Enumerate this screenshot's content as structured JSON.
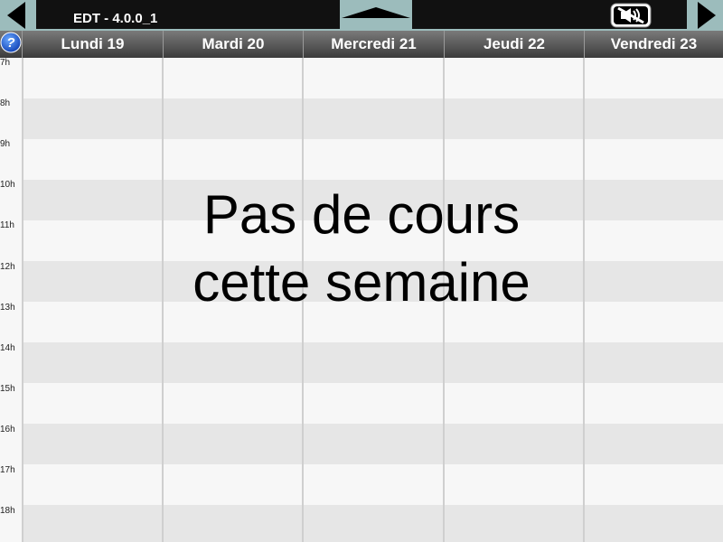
{
  "topbar": {
    "title": "EDT - 4.0.0_1",
    "prev_icon": "triangle-left-icon",
    "next_icon": "triangle-right-icon",
    "collapse_icon": "triangle-up-icon",
    "mute_icon": "mute-icon"
  },
  "help_icon": "help-icon",
  "days": [
    "Lundi 19",
    "Mardi 20",
    "Mercredi 21",
    "Jeudi 22",
    "Vendredi 23"
  ],
  "hours": [
    "7h",
    "8h",
    "9h",
    "10h",
    "11h",
    "12h",
    "13h",
    "14h",
    "15h",
    "16h",
    "17h",
    "18h"
  ],
  "message": "Pas de cours cette semaine",
  "colors": {
    "accent": "#9cbcbc",
    "bar": "#111111",
    "header": "#555555",
    "band_dark": "#e6e6e6",
    "band_light": "#f7f7f7"
  }
}
